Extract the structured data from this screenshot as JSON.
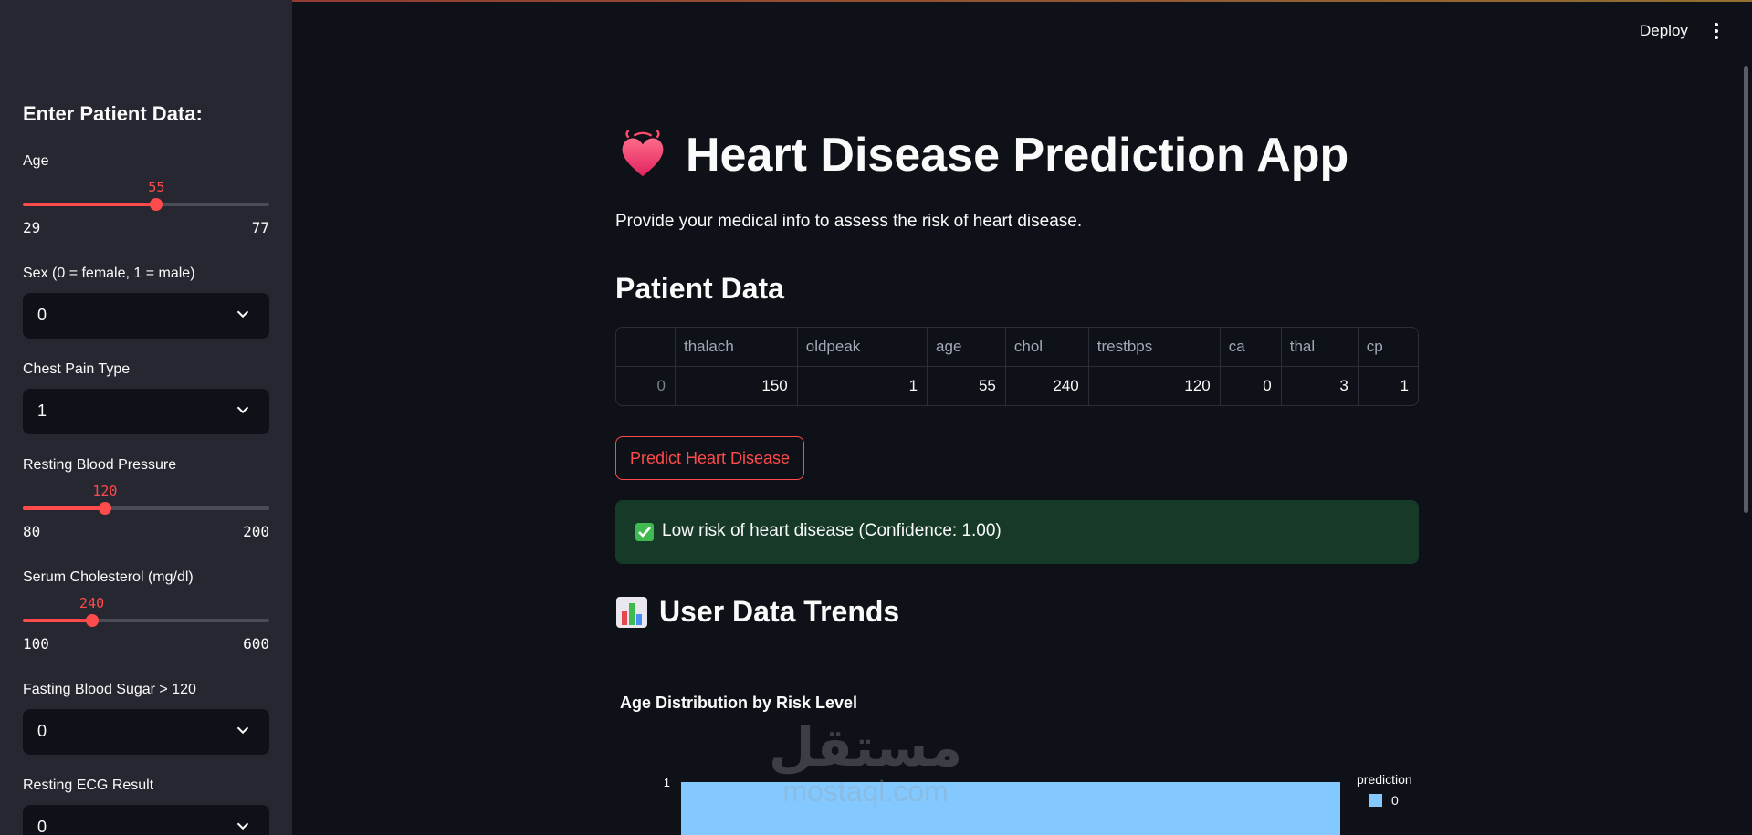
{
  "header": {
    "deploy_label": "Deploy"
  },
  "sidebar": {
    "title": "Enter Patient Data:",
    "age": {
      "label": "Age",
      "value": "55",
      "min": "29",
      "max": "77",
      "fraction": 0.542
    },
    "sex": {
      "label": "Sex (0 = female, 1 = male)",
      "value": "0"
    },
    "chest_pain": {
      "label": "Chest Pain Type",
      "value": "1"
    },
    "resting_bp": {
      "label": "Resting Blood Pressure",
      "value": "120",
      "min": "80",
      "max": "200",
      "fraction": 0.333
    },
    "cholesterol": {
      "label": "Serum Cholesterol (mg/dl)",
      "value": "240",
      "min": "100",
      "max": "600",
      "fraction": 0.28
    },
    "fbs": {
      "label": "Fasting Blood Sugar > 120",
      "value": "0"
    },
    "ecg": {
      "label": "Resting ECG Result",
      "value": "0"
    }
  },
  "main": {
    "title": "Heart Disease Prediction App",
    "subtitle": "Provide your medical info to assess the risk of heart disease.",
    "patient_heading": "Patient Data",
    "table": {
      "columns": [
        "",
        "thalach",
        "oldpeak",
        "age",
        "chol",
        "trestbps",
        "ca",
        "thal",
        "cp"
      ],
      "rows": [
        [
          "0",
          "150",
          "1",
          "55",
          "240",
          "120",
          "0",
          "3",
          "1"
        ]
      ]
    },
    "predict_button": "Predict Heart Disease",
    "result_message": "Low risk of heart disease (Confidence: 1.00)",
    "trends_heading": "User Data Trends"
  },
  "watermark": {
    "line1": "مستقل",
    "line2": "mostaql.com"
  },
  "colors": {
    "accent": "#ff4b4b",
    "success_bg": "#173928",
    "bar": "#83c9ff"
  },
  "chart_data": {
    "type": "bar",
    "title": "Age Distribution by Risk Level",
    "y_tick_labels": [
      "1"
    ],
    "series": [
      {
        "name": "0",
        "values": [
          1
        ]
      }
    ],
    "legend_title": "prediction",
    "legend_position": "right"
  }
}
